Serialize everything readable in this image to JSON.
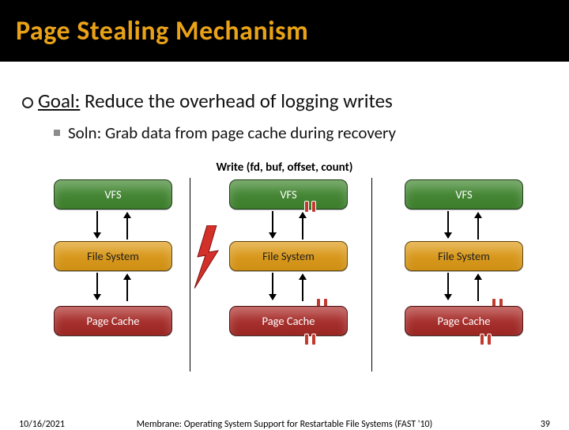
{
  "header": {
    "title": "Page Stealing Mechanism"
  },
  "body": {
    "goal_label": "Goal:",
    "goal_text": " Reduce the overhead of logging writes",
    "soln_text": "Soln: Grab data from page cache during recovery",
    "write_caption": "Write (fd, buf, offset, count)"
  },
  "labels": {
    "vfs": "VFS",
    "fs": "File System",
    "pc": "Page Cache"
  },
  "footer": {
    "date": "10/16/2021",
    "caption": "Membrane: Operating System Support for Restartable File Systems (FAST '10)",
    "slide_no": "39"
  }
}
